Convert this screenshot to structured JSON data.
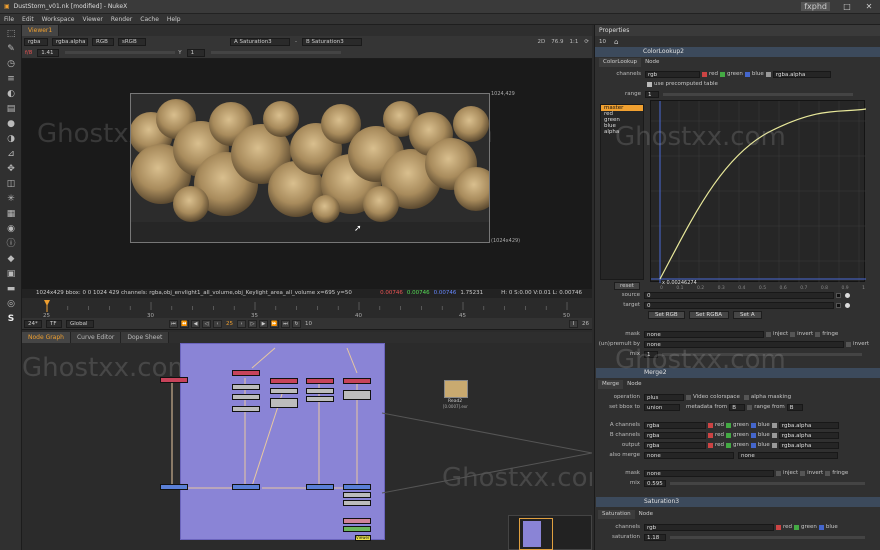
{
  "window": {
    "title": "DustStorm_v01.nk [modified] - NukeX",
    "controls": [
      "–",
      "□",
      "✕"
    ]
  },
  "menu": [
    "File",
    "Edit",
    "Workspace",
    "Viewer",
    "Render",
    "Cache",
    "Help"
  ],
  "left_tools": [
    "cursor",
    "brush",
    "clock",
    "channels",
    "palette",
    "transform",
    "sphere",
    "keyer",
    "merge",
    "move",
    "cube",
    "star",
    "particles",
    "circle",
    "eye",
    "tag",
    "layers",
    "info",
    "S"
  ],
  "viewer": {
    "tab": "Viewer1",
    "channels": "rgba",
    "alpha": "rgba.alpha",
    "colorspace_in": "RGB",
    "lut": "sRGB",
    "a_input": "A  Saturation3",
    "b_input": "B  Saturation3",
    "mode": "2D",
    "zoom": "76.9",
    "ratio": "1:1",
    "gain_label": "f/8",
    "gain": "1.41",
    "y_label": "Y",
    "y": "1",
    "frame_tag": "1024,429",
    "frame_tag_br": "(1024x429)"
  },
  "status_bar": {
    "text": "1024x429  bbox: 0 0 1024 429 channels: rgba,obj_envlight1_all_volume,obj_Keylight_area_all_volume  x=695 y=50",
    "r": "0.00746",
    "g": "0.00746",
    "b": "0.00746",
    "a": "1.75231",
    "hsvl": "H: 0 S:0.00 V:0.01  L: 0.00746"
  },
  "timeline": {
    "ticks": [
      "25",
      "30",
      "35",
      "40",
      "45",
      "50"
    ],
    "start": "25",
    "end": "50",
    "range_end": "26",
    "fps": "24*",
    "tc": "TF",
    "scope": "Global",
    "current": "25",
    "step": "10"
  },
  "nodegraph": {
    "tabs": [
      "Node Graph",
      "Curve Editor",
      "Dope Sheet"
    ],
    "read_node": "Read2",
    "read_sub": "[0.0007].exr",
    "viewer_label": "Viewer1"
  },
  "properties": {
    "title": "Properties",
    "count": "10",
    "colorlookup": {
      "name": "ColorLookup2",
      "tabs": [
        "ColorLookup",
        "Node"
      ],
      "channels_label": "channels",
      "channels": "rgb",
      "checks": [
        "red",
        "green",
        "blue"
      ],
      "alpha": "rgba.alpha",
      "precomputed": "use precomputed table",
      "range_label": "range",
      "range": "1",
      "curves": [
        "master",
        "red",
        "green",
        "blue",
        "alpha"
      ],
      "readout": "x 0.00246274",
      "x_ticks": [
        "0",
        "0.1",
        "0.2",
        "0.3",
        "0.4",
        "0.5",
        "0.6",
        "0.7",
        "0.8",
        "0.9",
        "1"
      ],
      "reset": "reset",
      "source_label": "source",
      "source": "0",
      "target_label": "target",
      "target": "0",
      "buttons": [
        "Set RGB",
        "Set RGBA",
        "Set A"
      ],
      "mask_label": "mask",
      "mask": "none",
      "inject": "inject",
      "invert": "invert",
      "fringe": "fringe",
      "unpremult_label": "(un)premult by",
      "unpremult": "none",
      "mix_label": "mix",
      "mix": "1"
    },
    "merge": {
      "name": "Merge2",
      "tabs": [
        "Merge",
        "Node"
      ],
      "operation_label": "operation",
      "operation": "plus",
      "video_colorspace": "Video colorspace",
      "alpha_masking": "alpha masking",
      "bbox_label": "set bbox to",
      "bbox": "union",
      "metadata_label": "metadata from",
      "metadata": "B",
      "range_from_label": "range from",
      "range_from": "B",
      "a_channels_label": "A channels",
      "a_channels": "rgba",
      "b_channels_label": "B channels",
      "b_channels": "rgba",
      "output_label": "output",
      "output": "rgba",
      "also_merge_label": "also merge",
      "also_merge": "none",
      "also_merge2": "none",
      "rgb_checks": [
        "red",
        "green",
        "blue"
      ],
      "alpha_field": "rgba.alpha",
      "mask_label": "mask",
      "mask": "none",
      "inject": "inject",
      "invert": "invert",
      "fringe": "fringe",
      "mix_label": "mix",
      "mix": "0.595"
    },
    "saturation": {
      "name": "Saturation3",
      "tabs": [
        "Saturation",
        "Node"
      ],
      "channels_label": "channels",
      "channels": "rgb",
      "checks": [
        "red",
        "green",
        "blue"
      ],
      "saturation_label": "saturation",
      "saturation": "1.18"
    }
  },
  "watermark": "Ghostxx.com",
  "corner_logo": "fxphd",
  "colors": {
    "accent": "#f0a030",
    "backdrop": "#8a84d6",
    "curve": "#e8e89a",
    "node_header": "#3c4a5c"
  }
}
